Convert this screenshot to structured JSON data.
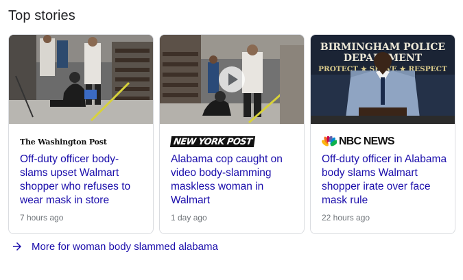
{
  "section": {
    "title": "Top stories"
  },
  "stories": [
    {
      "source": "The Washington Post",
      "headline": "Off-duty officer body-slams upset Walmart shopper who refuses to wear mask in store",
      "age": "7 hours ago"
    },
    {
      "source": "NEW YORK POST",
      "headline": "Alabama cop caught on video body-slamming maskless woman in Walmart",
      "age": "1 day ago"
    },
    {
      "source": "NBC NEWS",
      "headline": "Off-duty officer in Alabama body slams Walmart shopper irate over face mask rule",
      "age": "22 hours ago"
    }
  ],
  "thumb3": {
    "line1": "BIRMINGHAM POLICE",
    "line2": "DEPARTMENT",
    "line3": "PROTECT ★ SERVE ★ RESPECT"
  },
  "more": {
    "label": "More for woman body slammed alabama"
  },
  "colors": {
    "link": "#1a0dab",
    "muted": "#70757a",
    "border": "#dadce0",
    "arrow": "#1a0dab"
  }
}
